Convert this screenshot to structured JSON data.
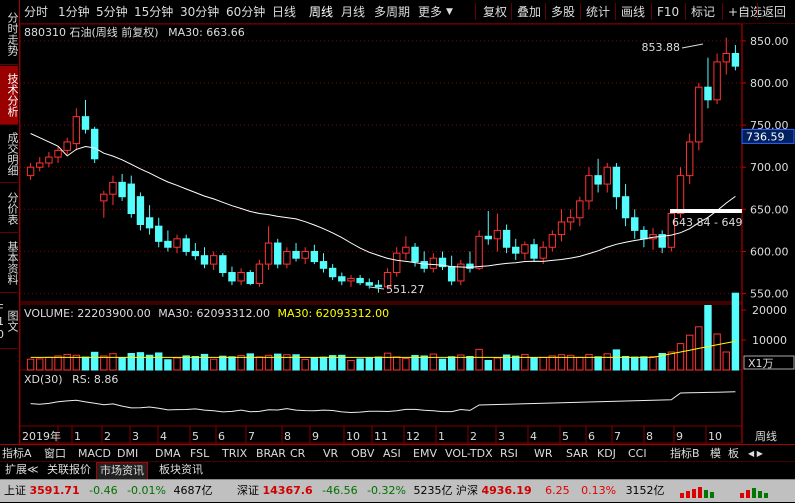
{
  "toolbar": {
    "left_items": [
      "分时",
      "1分钟",
      "5分钟",
      "15分钟",
      "30分钟",
      "60分钟",
      "日线",
      "周线",
      "月线",
      "多周期",
      "更多"
    ],
    "active": "周线",
    "right_items": [
      "复权",
      "叠加",
      "多股",
      "统计",
      "画线",
      "F10",
      "标记",
      "+自选",
      "返回"
    ]
  },
  "left_tabs": [
    "分时走势",
    "技术分析",
    "成交明细",
    "分价表",
    "基本资料",
    "图文F10"
  ],
  "left_tab_active": "技术分析",
  "main": {
    "code_title": "880310 石油(周线 前复权)",
    "ma_label": "MA30: 663.66",
    "high_label": "853.88",
    "low_label": "551.27",
    "range_label": "643.84 - 649",
    "current_price": "736.59",
    "y_ticks": [
      "850.00",
      "800.00",
      "750.00",
      "700.00",
      "650.00",
      "600.00",
      "550.00"
    ]
  },
  "volume": {
    "label": "VOLUME: 22203900.00",
    "ma_label": "MA30: 62093312.00",
    "ma_label2": "MA30: 62093312.00",
    "y_ticks": [
      "20000",
      "10000"
    ],
    "unit": "X1万"
  },
  "indicator": {
    "label": "XD(30)",
    "value": "RS: 8.86"
  },
  "time_axis": {
    "labels": [
      "2019年",
      "1",
      "2",
      "3",
      "4",
      "5",
      "6",
      "7",
      "8",
      "9",
      "10",
      "11",
      "12",
      "1",
      "2",
      "3",
      "4",
      "5",
      "6",
      "7",
      "8",
      "9",
      "10"
    ],
    "period": "周线"
  },
  "indicator_tabs": [
    "指标A",
    "窗口",
    "MACD",
    "DMI",
    "DMA",
    "FSL",
    "TRIX",
    "BRAR",
    "CR",
    "VR",
    "OBV",
    "ASI",
    "EMV",
    "VOL-TDX",
    "RSI",
    "WR",
    "SAR",
    "KDJ",
    "CCI",
    "指标B",
    "模",
    "板"
  ],
  "news_tabs": [
    "扩展≪",
    "关联报价",
    "市场资讯",
    "板块资讯"
  ],
  "news_active": "市场资讯",
  "status": {
    "sh_label": "上证",
    "sh_value": "3591.71",
    "sh_change": "-0.46",
    "sh_pct": "-0.01%",
    "sh_amount": "4687亿",
    "sz_label": "深证",
    "sz_value": "14367.6",
    "sz_change": "-46.56",
    "sz_pct": "-0.32%",
    "sz_amount": "5235亿",
    "hs_label": "沪深",
    "hs_value": "4936.19",
    "hs_change": "6.25",
    "hs_pct": "0.13%",
    "hs_amount": "3152亿"
  },
  "colors": {
    "up": "#ff3232",
    "down": "#54fcfc",
    "ma": "#ffffff",
    "vol_ma": "#ffff00",
    "grid": "#800000"
  },
  "chart_data": {
    "type": "candlestick",
    "period": "weekly",
    "ylim": [
      540,
      870
    ],
    "high": 853.88,
    "low": 551.27,
    "weeks": [
      {
        "o": 690,
        "h": 705,
        "l": 685,
        "c": 700
      },
      {
        "o": 700,
        "h": 712,
        "l": 695,
        "c": 705
      },
      {
        "o": 705,
        "h": 718,
        "l": 700,
        "c": 712
      },
      {
        "o": 712,
        "h": 725,
        "l": 705,
        "c": 720
      },
      {
        "o": 720,
        "h": 735,
        "l": 715,
        "c": 730
      },
      {
        "o": 728,
        "h": 770,
        "l": 720,
        "c": 760
      },
      {
        "o": 760,
        "h": 780,
        "l": 740,
        "c": 745
      },
      {
        "o": 745,
        "h": 748,
        "l": 705,
        "c": 710
      },
      {
        "o": 660,
        "h": 672,
        "l": 640,
        "c": 668
      },
      {
        "o": 668,
        "h": 690,
        "l": 655,
        "c": 682
      },
      {
        "o": 682,
        "h": 692,
        "l": 660,
        "c": 665
      },
      {
        "o": 680,
        "h": 690,
        "l": 640,
        "c": 645
      },
      {
        "o": 665,
        "h": 670,
        "l": 625,
        "c": 632
      },
      {
        "o": 640,
        "h": 655,
        "l": 620,
        "c": 628
      },
      {
        "o": 630,
        "h": 640,
        "l": 605,
        "c": 612
      },
      {
        "o": 612,
        "h": 625,
        "l": 600,
        "c": 605
      },
      {
        "o": 605,
        "h": 620,
        "l": 598,
        "c": 615
      },
      {
        "o": 615,
        "h": 620,
        "l": 595,
        "c": 600
      },
      {
        "o": 600,
        "h": 610,
        "l": 590,
        "c": 595
      },
      {
        "o": 595,
        "h": 605,
        "l": 580,
        "c": 585
      },
      {
        "o": 585,
        "h": 600,
        "l": 578,
        "c": 595
      },
      {
        "o": 595,
        "h": 598,
        "l": 570,
        "c": 575
      },
      {
        "o": 575,
        "h": 582,
        "l": 560,
        "c": 565
      },
      {
        "o": 565,
        "h": 580,
        "l": 560,
        "c": 575
      },
      {
        "o": 575,
        "h": 578,
        "l": 560,
        "c": 562
      },
      {
        "o": 562,
        "h": 590,
        "l": 558,
        "c": 585
      },
      {
        "o": 585,
        "h": 630,
        "l": 578,
        "c": 610
      },
      {
        "o": 610,
        "h": 615,
        "l": 580,
        "c": 585
      },
      {
        "o": 585,
        "h": 605,
        "l": 580,
        "c": 600
      },
      {
        "o": 600,
        "h": 610,
        "l": 588,
        "c": 592
      },
      {
        "o": 592,
        "h": 605,
        "l": 585,
        "c": 600
      },
      {
        "o": 600,
        "h": 608,
        "l": 585,
        "c": 588
      },
      {
        "o": 588,
        "h": 598,
        "l": 575,
        "c": 580
      },
      {
        "o": 580,
        "h": 585,
        "l": 566,
        "c": 570
      },
      {
        "o": 570,
        "h": 575,
        "l": 560,
        "c": 565
      },
      {
        "o": 565,
        "h": 572,
        "l": 558,
        "c": 568
      },
      {
        "o": 568,
        "h": 572,
        "l": 560,
        "c": 563
      },
      {
        "o": 563,
        "h": 568,
        "l": 556,
        "c": 560
      },
      {
        "o": 560,
        "h": 566,
        "l": 551,
        "c": 558
      },
      {
        "o": 558,
        "h": 580,
        "l": 555,
        "c": 575
      },
      {
        "o": 575,
        "h": 605,
        "l": 570,
        "c": 598
      },
      {
        "o": 598,
        "h": 618,
        "l": 590,
        "c": 605
      },
      {
        "o": 605,
        "h": 610,
        "l": 582,
        "c": 588
      },
      {
        "o": 588,
        "h": 600,
        "l": 575,
        "c": 580
      },
      {
        "o": 580,
        "h": 598,
        "l": 575,
        "c": 592
      },
      {
        "o": 592,
        "h": 600,
        "l": 578,
        "c": 582
      },
      {
        "o": 582,
        "h": 595,
        "l": 560,
        "c": 565
      },
      {
        "o": 565,
        "h": 590,
        "l": 560,
        "c": 585
      },
      {
        "o": 585,
        "h": 600,
        "l": 575,
        "c": 580
      },
      {
        "o": 580,
        "h": 625,
        "l": 578,
        "c": 618
      },
      {
        "o": 618,
        "h": 648,
        "l": 608,
        "c": 615
      },
      {
        "o": 615,
        "h": 645,
        "l": 600,
        "c": 625
      },
      {
        "o": 625,
        "h": 632,
        "l": 598,
        "c": 605
      },
      {
        "o": 605,
        "h": 615,
        "l": 590,
        "c": 598
      },
      {
        "o": 598,
        "h": 612,
        "l": 590,
        "c": 608
      },
      {
        "o": 608,
        "h": 615,
        "l": 588,
        "c": 592
      },
      {
        "o": 592,
        "h": 612,
        "l": 585,
        "c": 605
      },
      {
        "o": 605,
        "h": 625,
        "l": 600,
        "c": 620
      },
      {
        "o": 620,
        "h": 650,
        "l": 612,
        "c": 635
      },
      {
        "o": 635,
        "h": 650,
        "l": 625,
        "c": 640
      },
      {
        "o": 640,
        "h": 665,
        "l": 630,
        "c": 660
      },
      {
        "o": 660,
        "h": 700,
        "l": 650,
        "c": 690
      },
      {
        "o": 690,
        "h": 710,
        "l": 670,
        "c": 680
      },
      {
        "o": 680,
        "h": 705,
        "l": 670,
        "c": 700
      },
      {
        "o": 700,
        "h": 705,
        "l": 650,
        "c": 665
      },
      {
        "o": 665,
        "h": 680,
        "l": 630,
        "c": 640
      },
      {
        "o": 640,
        "h": 650,
        "l": 615,
        "c": 625
      },
      {
        "o": 625,
        "h": 630,
        "l": 605,
        "c": 615
      },
      {
        "o": 615,
        "h": 628,
        "l": 602,
        "c": 620
      },
      {
        "o": 620,
        "h": 625,
        "l": 598,
        "c": 605
      },
      {
        "o": 605,
        "h": 650,
        "l": 600,
        "c": 645
      },
      {
        "o": 645,
        "h": 700,
        "l": 640,
        "c": 690
      },
      {
        "o": 690,
        "h": 740,
        "l": 680,
        "c": 730
      },
      {
        "o": 730,
        "h": 800,
        "l": 720,
        "c": 795
      },
      {
        "o": 795,
        "h": 830,
        "l": 770,
        "c": 780
      },
      {
        "o": 780,
        "h": 835,
        "l": 775,
        "c": 825
      },
      {
        "o": 825,
        "h": 853.88,
        "l": 810,
        "c": 835
      },
      {
        "o": 835,
        "h": 845,
        "l": 815,
        "c": 820
      }
    ]
  }
}
